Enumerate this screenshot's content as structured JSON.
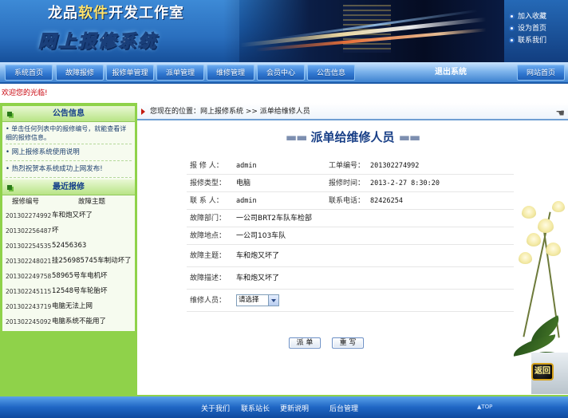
{
  "header": {
    "site_name_pre": "龙品",
    "site_name_hl": "软件",
    "site_name_post": "开发工作室",
    "system_title": "网上报修系统",
    "links": [
      "加入收藏",
      "设为首页",
      "联系我们"
    ]
  },
  "nav": {
    "items": [
      "系统首页",
      "故障报修",
      "报修单管理",
      "派单管理",
      "维修管理",
      "会员中心",
      "公告信息"
    ],
    "logout": "退出系统",
    "home": "网站首页"
  },
  "welcome": "欢迎您的光临!",
  "sidebar": {
    "notice_title": "公告信息",
    "notice_first": "• 单击任何列表中的报修编号，就能查看详细的报修信息。",
    "notices": [
      "• 网上报修系统使用说明",
      "• 热烈祝贺本系统成功上网发布!"
    ],
    "recent_title": "最近报修",
    "col_no": "报修编号",
    "col_subject": "故障主题",
    "repairs": [
      {
        "no": "201302274992",
        "subject": "车和炮又坏了"
      },
      {
        "no": "201302256487",
        "subject": "坏"
      },
      {
        "no": "201302254535",
        "subject": "52456363"
      },
      {
        "no": "201302248021",
        "subject": "挂256985745车制动坏了"
      },
      {
        "no": "201302249758",
        "subject": "58965号车电机坏"
      },
      {
        "no": "201302245115",
        "subject": "12548号车轮胎坏"
      },
      {
        "no": "201302243719",
        "subject": "电脑无法上网"
      },
      {
        "no": "201302245092",
        "subject": "电脑系统不能用了"
      }
    ]
  },
  "breadcrumb": "您现在的位置：网上报修系统 >> 派单给维修人员",
  "page_title": "派单给维修人员",
  "page_title_dash_left": "▬▬",
  "page_title_dash_right": "▬▬",
  "form": {
    "reporter_label": "报 修 人：",
    "reporter": "admin",
    "order_no_label": "工单编号：",
    "order_no": "201302274992",
    "type_label": "报修类型：",
    "type": "电脑",
    "time_label": "报修时间：",
    "time": "2013-2-27 8:30:20",
    "contact_label": "联 系 人：",
    "contact": "admin",
    "phone_label": "联系电话：",
    "phone": "82426254",
    "dept_label": "故障部门：",
    "dept": "一公司BRT2车队车检部",
    "location_label": "故障地点：",
    "location": "一公司103车队",
    "subject_label": "故障主题：",
    "subject": "车和炮又坏了",
    "desc_label": "故障描述：",
    "desc": "车和炮又坏了",
    "staff_label": "维修人员：",
    "staff_select": "请选择"
  },
  "buttons": {
    "dispatch": "派 单",
    "rewrite": "重 写"
  },
  "back_label": "返回",
  "footer": {
    "links": [
      "关于我们",
      "联系站长",
      "更新说明",
      "后台管理"
    ],
    "top": "▲TOP"
  },
  "colors": {
    "sidebar": "#8fd24a",
    "nav": "#2f76cf",
    "heading": "#173e86",
    "welcome": "#c8000a"
  }
}
